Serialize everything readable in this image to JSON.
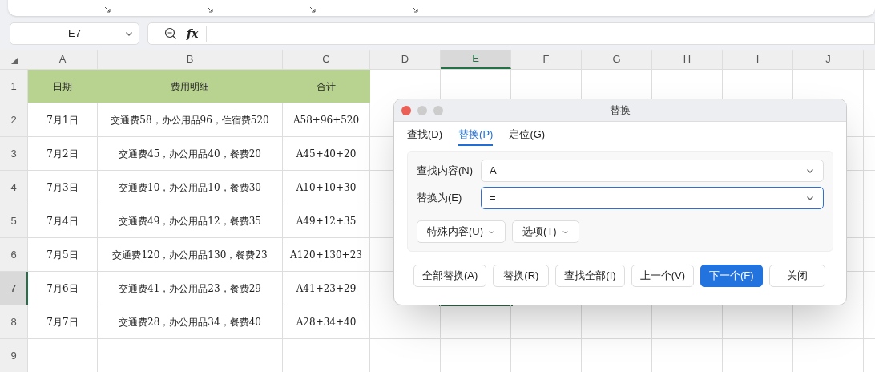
{
  "formula_bar": {
    "name_box": "E7",
    "fx": "fx"
  },
  "sheet": {
    "columns": [
      {
        "label": "A",
        "selected": false
      },
      {
        "label": "B",
        "selected": false
      },
      {
        "label": "C",
        "selected": false
      },
      {
        "label": "D",
        "selected": false
      },
      {
        "label": "E",
        "selected": true
      },
      {
        "label": "F",
        "selected": false
      },
      {
        "label": "G",
        "selected": false
      },
      {
        "label": "H",
        "selected": false
      },
      {
        "label": "I",
        "selected": false
      },
      {
        "label": "J",
        "selected": false
      }
    ],
    "rows": [
      {
        "label": "1",
        "selected": false,
        "kind": "header",
        "cells": [
          "日期",
          "费用明细",
          "合计"
        ]
      },
      {
        "label": "2",
        "selected": false,
        "kind": "data",
        "cells": [
          "7月1日",
          "交通费58，办公用品96，住宿费520",
          "A58+96+520"
        ]
      },
      {
        "label": "3",
        "selected": false,
        "kind": "data",
        "cells": [
          "7月2日",
          "交通费45，办公用品40，餐费20",
          "A45+40+20"
        ]
      },
      {
        "label": "4",
        "selected": false,
        "kind": "data",
        "cells": [
          "7月3日",
          "交通费10，办公用品10，餐费30",
          "A10+10+30"
        ]
      },
      {
        "label": "5",
        "selected": false,
        "kind": "data",
        "cells": [
          "7月4日",
          "交通费49，办公用品12，餐费35",
          "A49+12+35"
        ]
      },
      {
        "label": "6",
        "selected": false,
        "kind": "data",
        "cells": [
          "7月5日",
          "交通费120，办公用品130，餐费23",
          "A120+130+23"
        ]
      },
      {
        "label": "7",
        "selected": true,
        "kind": "data",
        "cells": [
          "7月6日",
          "交通费41，办公用品23，餐费29",
          "A41+23+29"
        ]
      },
      {
        "label": "8",
        "selected": false,
        "kind": "data",
        "cells": [
          "7月7日",
          "交通费28，办公用品34，餐费40",
          "A28+34+40"
        ]
      },
      {
        "label": "9",
        "selected": false,
        "kind": "data",
        "cells": []
      }
    ]
  },
  "dialog": {
    "title": "替换",
    "tabs": [
      {
        "label": "查找(D)",
        "selected": false
      },
      {
        "label": "替换(P)",
        "selected": true
      },
      {
        "label": "定位(G)",
        "selected": false
      }
    ],
    "fields": [
      {
        "label": "查找内容(N)",
        "value": "A",
        "focused": false
      },
      {
        "label": "替换为(E)",
        "value": "=",
        "focused": true
      }
    ],
    "option_buttons": [
      "特殊内容(U)",
      "选项(T)"
    ],
    "buttons": [
      {
        "label": "全部替换(A)",
        "primary": false
      },
      {
        "label": "替换(R)",
        "primary": false
      },
      {
        "label": "查找全部(I)",
        "primary": false
      },
      {
        "label": "上一个(V)",
        "primary": false
      },
      {
        "label": "下一个(F)",
        "primary": true
      },
      {
        "label": "关闭",
        "primary": false
      }
    ]
  }
}
